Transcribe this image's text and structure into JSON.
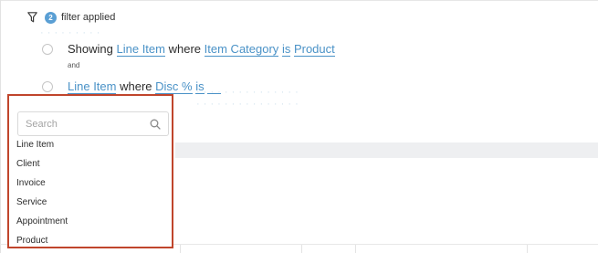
{
  "filter": {
    "count": "2",
    "applied_label": "filter applied"
  },
  "rules": [
    {
      "prefix": "Showing",
      "entity": "Line Item",
      "where": "where",
      "field": "Item Category",
      "operator": "is",
      "value": "Product"
    },
    {
      "entity": "Line Item",
      "where": "where",
      "field": "Disc %",
      "operator": "is"
    }
  ],
  "join_label": "and",
  "search": {
    "placeholder": "Search"
  },
  "dropdown_items": [
    "Line Item",
    "Client",
    "Invoice",
    "Service",
    "Appointment",
    "Product"
  ],
  "colors": {
    "accent": "#4a92c7",
    "badge": "#5a9fd4",
    "highlight_border": "#c0452c"
  },
  "icons": [
    "funnel-icon",
    "search-icon"
  ]
}
